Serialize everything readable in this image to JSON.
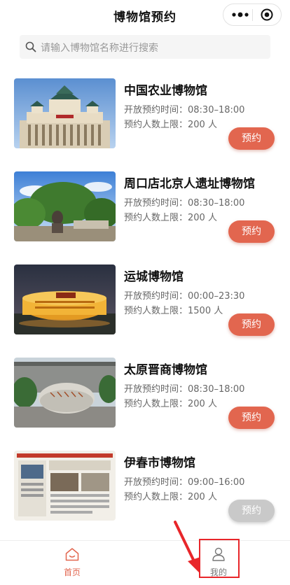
{
  "header": {
    "title": "博物馆预约",
    "more_icon": "more-dots-icon",
    "close_icon": "target-circle-icon"
  },
  "search": {
    "placeholder": "请输入博物馆名称进行搜索",
    "icon": "search-icon"
  },
  "museums": [
    {
      "name": "中国农业博物馆",
      "hours": "开放预约时间：08:30–18:00",
      "limit": "预约人数上限：200 人",
      "button": "预约",
      "enabled": true
    },
    {
      "name": "周口店北京人遗址博物馆",
      "hours": "开放预约时间：08:30–18:00",
      "limit": "预约人数上限：200 人",
      "button": "预约",
      "enabled": true
    },
    {
      "name": "运城博物馆",
      "hours": "开放预约时间：00:00–23:30",
      "limit": "预约人数上限：1500 人",
      "button": "预约",
      "enabled": true
    },
    {
      "name": "太原晋商博物馆",
      "hours": "开放预约时间：08:30–18:00",
      "limit": "预约人数上限：200 人",
      "button": "预约",
      "enabled": true
    },
    {
      "name": "伊春市博物馆",
      "hours": "开放预约时间：09:00–16:00",
      "limit": "预约人数上限：200 人",
      "button": "预约",
      "enabled": false
    }
  ],
  "tabbar": {
    "home_label": "首页",
    "mine_label": "我的",
    "home_icon": "home-icon",
    "mine_icon": "user-icon"
  },
  "colors": {
    "accent": "#e2664f",
    "disabled": "#c9c9c9",
    "highlight": "#e8262a"
  }
}
